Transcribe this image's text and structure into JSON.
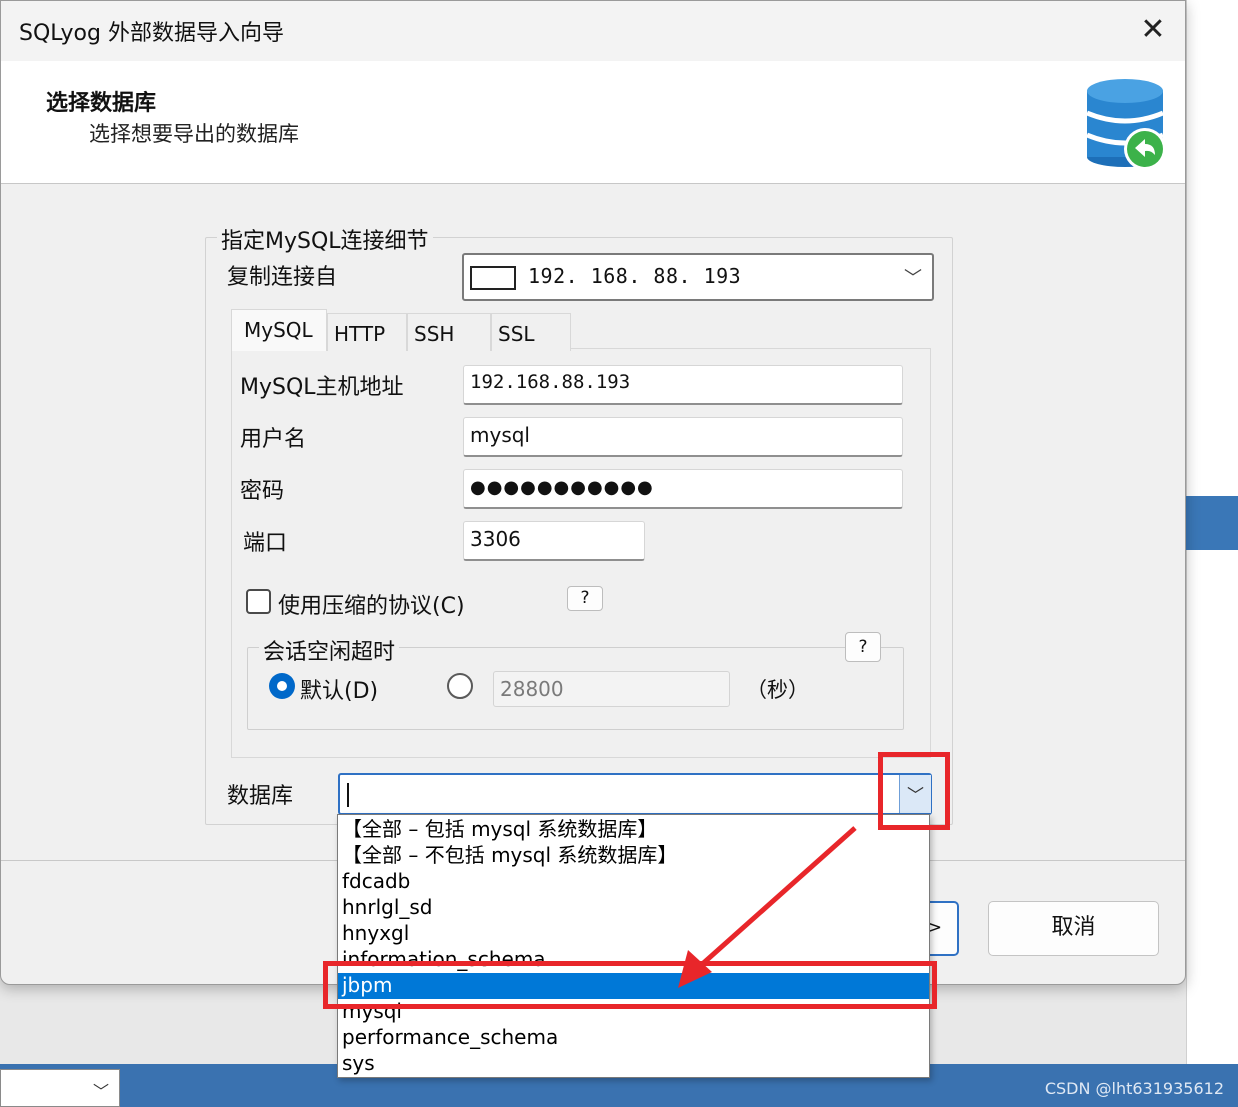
{
  "window": {
    "title": "SQLyog 外部数据导入向导",
    "close_glyph": "✕"
  },
  "header": {
    "title": "选择数据库",
    "subtitle": "选择想要导出的数据库"
  },
  "connection": {
    "group_title": "指定MySQL连接细节",
    "copy_from_label": "复制连接自",
    "copy_from_value": "192. 168. 88. 193",
    "tabs": [
      {
        "label": "MySQL",
        "active": true
      },
      {
        "label": "HTTP",
        "active": false
      },
      {
        "label": "SSH",
        "active": false
      },
      {
        "label": "SSL",
        "active": false
      }
    ],
    "host_label": "MySQL主机地址",
    "host_value": "192.168.88.193",
    "user_label": "用户名",
    "user_value": "mysql",
    "password_label": "密码",
    "password_value": "●●●●●●●●●●●",
    "port_label": "端口",
    "port_value": "3306",
    "compress_label": "使用压缩的协议(C)",
    "compress_checked": false,
    "help_label": "?",
    "session_title": "会话空闲超时",
    "default_label": "默认(D)",
    "timeout_value": "28800",
    "seconds_label": "（秒）"
  },
  "database": {
    "label": "数据库",
    "value": "",
    "options": [
      "【全部 – 包括 mysql 系统数据库】",
      "【全部 – 不包括 mysql 系统数据库】",
      "fdcadb",
      "hnrlgl_sd",
      "hnyxgl",
      "information_schema",
      "jbpm",
      "mysql",
      "performance_schema",
      "sys"
    ],
    "selected": "jbpm"
  },
  "footer": {
    "next_label": ">",
    "cancel_label": "取消"
  },
  "watermark": "CSDN @lht631935612",
  "colors": {
    "accent": "#0078d7",
    "annotation": "#e8262a",
    "taskbar": "#3a72b0"
  }
}
